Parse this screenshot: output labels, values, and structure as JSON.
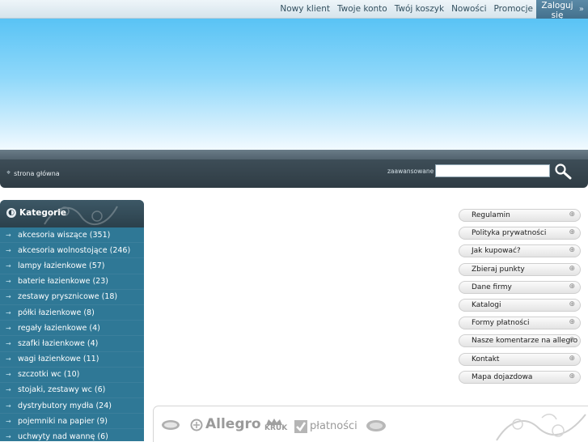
{
  "topnav": {
    "items": [
      {
        "label": "Nowy klient"
      },
      {
        "label": "Twoje konto"
      },
      {
        "label": "Twój koszyk"
      },
      {
        "label": "Nowości"
      },
      {
        "label": "Promocje"
      }
    ],
    "login": "Zaloguj się"
  },
  "breadcrumb": {
    "home": "strona główna"
  },
  "search": {
    "advanced": "zaawansowane",
    "value": "",
    "placeholder": ""
  },
  "sidebar": {
    "title": "Kategorie",
    "items": [
      {
        "label": "akcesoria wiszące (351)"
      },
      {
        "label": "akcesoria wolnostojące (246)"
      },
      {
        "label": "lampy łazienkowe (57)"
      },
      {
        "label": "baterie łazienkowe (23)"
      },
      {
        "label": "zestawy prysznicowe (18)"
      },
      {
        "label": "półki łazienkowe (8)"
      },
      {
        "label": "regały łazienkowe (4)"
      },
      {
        "label": "szafki łazienkowe (4)"
      },
      {
        "label": "wagi łazienkowe (11)"
      },
      {
        "label": "szczotki wc (10)"
      },
      {
        "label": "stojaki, zestawy wc (6)"
      },
      {
        "label": "dystrybutory mydła (24)"
      },
      {
        "label": "pojemniki na papier (9)"
      },
      {
        "label": "uchwyty nad wannę (6)"
      }
    ]
  },
  "right_menu": {
    "items": [
      {
        "label": "Regulamin"
      },
      {
        "label": "Polityka prywatności"
      },
      {
        "label": "Jak kupować?"
      },
      {
        "label": "Zbieraj punkty"
      },
      {
        "label": "Dane firmy"
      },
      {
        "label": "Katalogi"
      },
      {
        "label": "Formy płatności"
      },
      {
        "label": "Nasze komentarze na allegro"
      },
      {
        "label": "Kontakt"
      },
      {
        "label": "Mapa dojazdowa"
      }
    ]
  },
  "logos": {
    "allegro": "Allegro",
    "kruk": "KRUK",
    "platnosci": "płatności"
  },
  "colors": {
    "sidebar": "#2f7896",
    "bar": "#2f3c44",
    "banner": "#59c3f5"
  }
}
